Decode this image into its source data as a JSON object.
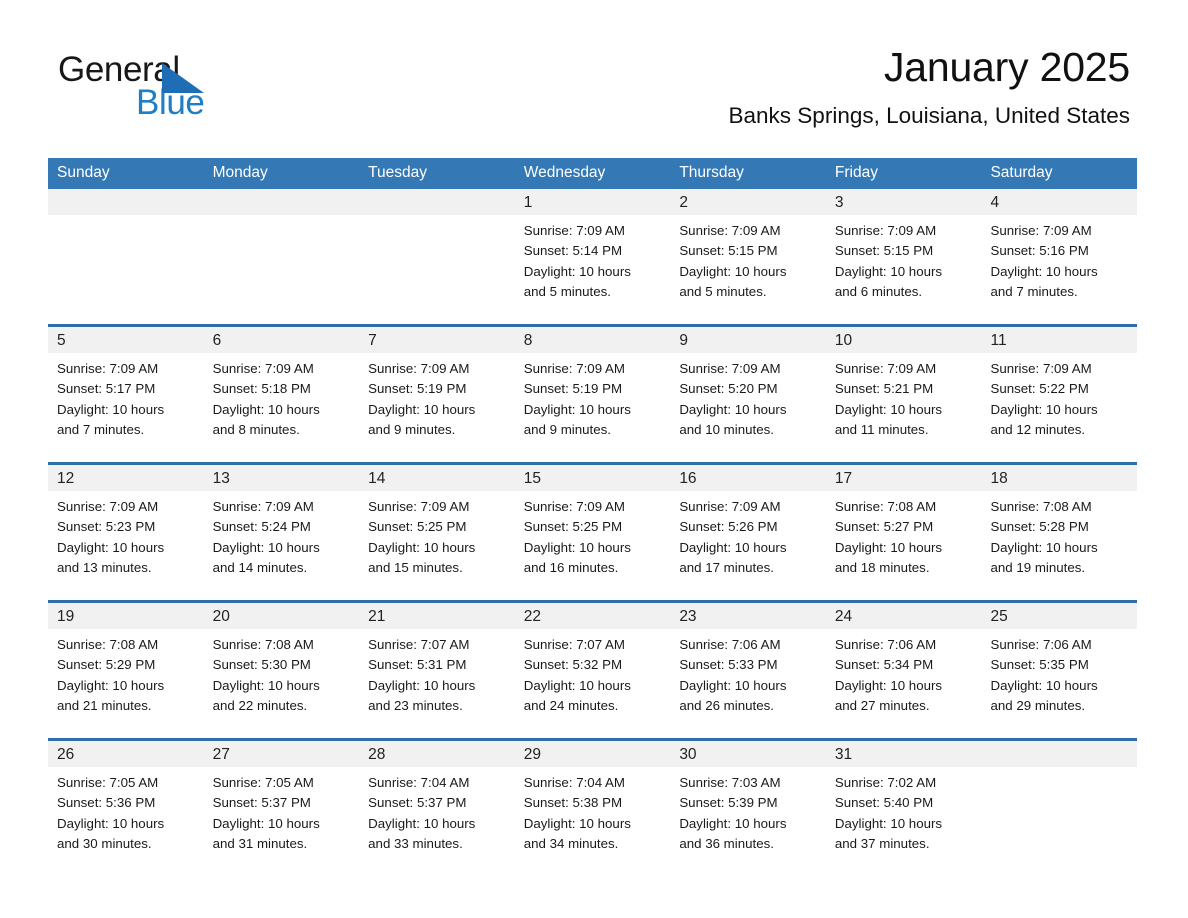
{
  "brand": {
    "name_part1": "General",
    "name_part2": "Blue",
    "flag_icon": "blue-triangle-flag-icon",
    "blue": "#1f7ec4"
  },
  "header": {
    "month_title": "January 2025",
    "location": "Banks Springs, Louisiana, United States"
  },
  "calendar": {
    "header_bg": "#3479b5",
    "row_border": "#2f6ea8",
    "day_band_bg": "#f1f1f1",
    "weekdays": [
      "Sunday",
      "Monday",
      "Tuesday",
      "Wednesday",
      "Thursday",
      "Friday",
      "Saturday"
    ],
    "weeks": [
      [
        {
          "day": "",
          "sunrise": "",
          "sunset": "",
          "daylight1": "",
          "daylight2": ""
        },
        {
          "day": "",
          "sunrise": "",
          "sunset": "",
          "daylight1": "",
          "daylight2": ""
        },
        {
          "day": "",
          "sunrise": "",
          "sunset": "",
          "daylight1": "",
          "daylight2": ""
        },
        {
          "day": "1",
          "sunrise": "Sunrise: 7:09 AM",
          "sunset": "Sunset: 5:14 PM",
          "daylight1": "Daylight: 10 hours",
          "daylight2": "and 5 minutes."
        },
        {
          "day": "2",
          "sunrise": "Sunrise: 7:09 AM",
          "sunset": "Sunset: 5:15 PM",
          "daylight1": "Daylight: 10 hours",
          "daylight2": "and 5 minutes."
        },
        {
          "day": "3",
          "sunrise": "Sunrise: 7:09 AM",
          "sunset": "Sunset: 5:15 PM",
          "daylight1": "Daylight: 10 hours",
          "daylight2": "and 6 minutes."
        },
        {
          "day": "4",
          "sunrise": "Sunrise: 7:09 AM",
          "sunset": "Sunset: 5:16 PM",
          "daylight1": "Daylight: 10 hours",
          "daylight2": "and 7 minutes."
        }
      ],
      [
        {
          "day": "5",
          "sunrise": "Sunrise: 7:09 AM",
          "sunset": "Sunset: 5:17 PM",
          "daylight1": "Daylight: 10 hours",
          "daylight2": "and 7 minutes."
        },
        {
          "day": "6",
          "sunrise": "Sunrise: 7:09 AM",
          "sunset": "Sunset: 5:18 PM",
          "daylight1": "Daylight: 10 hours",
          "daylight2": "and 8 minutes."
        },
        {
          "day": "7",
          "sunrise": "Sunrise: 7:09 AM",
          "sunset": "Sunset: 5:19 PM",
          "daylight1": "Daylight: 10 hours",
          "daylight2": "and 9 minutes."
        },
        {
          "day": "8",
          "sunrise": "Sunrise: 7:09 AM",
          "sunset": "Sunset: 5:19 PM",
          "daylight1": "Daylight: 10 hours",
          "daylight2": "and 9 minutes."
        },
        {
          "day": "9",
          "sunrise": "Sunrise: 7:09 AM",
          "sunset": "Sunset: 5:20 PM",
          "daylight1": "Daylight: 10 hours",
          "daylight2": "and 10 minutes."
        },
        {
          "day": "10",
          "sunrise": "Sunrise: 7:09 AM",
          "sunset": "Sunset: 5:21 PM",
          "daylight1": "Daylight: 10 hours",
          "daylight2": "and 11 minutes."
        },
        {
          "day": "11",
          "sunrise": "Sunrise: 7:09 AM",
          "sunset": "Sunset: 5:22 PM",
          "daylight1": "Daylight: 10 hours",
          "daylight2": "and 12 minutes."
        }
      ],
      [
        {
          "day": "12",
          "sunrise": "Sunrise: 7:09 AM",
          "sunset": "Sunset: 5:23 PM",
          "daylight1": "Daylight: 10 hours",
          "daylight2": "and 13 minutes."
        },
        {
          "day": "13",
          "sunrise": "Sunrise: 7:09 AM",
          "sunset": "Sunset: 5:24 PM",
          "daylight1": "Daylight: 10 hours",
          "daylight2": "and 14 minutes."
        },
        {
          "day": "14",
          "sunrise": "Sunrise: 7:09 AM",
          "sunset": "Sunset: 5:25 PM",
          "daylight1": "Daylight: 10 hours",
          "daylight2": "and 15 minutes."
        },
        {
          "day": "15",
          "sunrise": "Sunrise: 7:09 AM",
          "sunset": "Sunset: 5:25 PM",
          "daylight1": "Daylight: 10 hours",
          "daylight2": "and 16 minutes."
        },
        {
          "day": "16",
          "sunrise": "Sunrise: 7:09 AM",
          "sunset": "Sunset: 5:26 PM",
          "daylight1": "Daylight: 10 hours",
          "daylight2": "and 17 minutes."
        },
        {
          "day": "17",
          "sunrise": "Sunrise: 7:08 AM",
          "sunset": "Sunset: 5:27 PM",
          "daylight1": "Daylight: 10 hours",
          "daylight2": "and 18 minutes."
        },
        {
          "day": "18",
          "sunrise": "Sunrise: 7:08 AM",
          "sunset": "Sunset: 5:28 PM",
          "daylight1": "Daylight: 10 hours",
          "daylight2": "and 19 minutes."
        }
      ],
      [
        {
          "day": "19",
          "sunrise": "Sunrise: 7:08 AM",
          "sunset": "Sunset: 5:29 PM",
          "daylight1": "Daylight: 10 hours",
          "daylight2": "and 21 minutes."
        },
        {
          "day": "20",
          "sunrise": "Sunrise: 7:08 AM",
          "sunset": "Sunset: 5:30 PM",
          "daylight1": "Daylight: 10 hours",
          "daylight2": "and 22 minutes."
        },
        {
          "day": "21",
          "sunrise": "Sunrise: 7:07 AM",
          "sunset": "Sunset: 5:31 PM",
          "daylight1": "Daylight: 10 hours",
          "daylight2": "and 23 minutes."
        },
        {
          "day": "22",
          "sunrise": "Sunrise: 7:07 AM",
          "sunset": "Sunset: 5:32 PM",
          "daylight1": "Daylight: 10 hours",
          "daylight2": "and 24 minutes."
        },
        {
          "day": "23",
          "sunrise": "Sunrise: 7:06 AM",
          "sunset": "Sunset: 5:33 PM",
          "daylight1": "Daylight: 10 hours",
          "daylight2": "and 26 minutes."
        },
        {
          "day": "24",
          "sunrise": "Sunrise: 7:06 AM",
          "sunset": "Sunset: 5:34 PM",
          "daylight1": "Daylight: 10 hours",
          "daylight2": "and 27 minutes."
        },
        {
          "day": "25",
          "sunrise": "Sunrise: 7:06 AM",
          "sunset": "Sunset: 5:35 PM",
          "daylight1": "Daylight: 10 hours",
          "daylight2": "and 29 minutes."
        }
      ],
      [
        {
          "day": "26",
          "sunrise": "Sunrise: 7:05 AM",
          "sunset": "Sunset: 5:36 PM",
          "daylight1": "Daylight: 10 hours",
          "daylight2": "and 30 minutes."
        },
        {
          "day": "27",
          "sunrise": "Sunrise: 7:05 AM",
          "sunset": "Sunset: 5:37 PM",
          "daylight1": "Daylight: 10 hours",
          "daylight2": "and 31 minutes."
        },
        {
          "day": "28",
          "sunrise": "Sunrise: 7:04 AM",
          "sunset": "Sunset: 5:37 PM",
          "daylight1": "Daylight: 10 hours",
          "daylight2": "and 33 minutes."
        },
        {
          "day": "29",
          "sunrise": "Sunrise: 7:04 AM",
          "sunset": "Sunset: 5:38 PM",
          "daylight1": "Daylight: 10 hours",
          "daylight2": "and 34 minutes."
        },
        {
          "day": "30",
          "sunrise": "Sunrise: 7:03 AM",
          "sunset": "Sunset: 5:39 PM",
          "daylight1": "Daylight: 10 hours",
          "daylight2": "and 36 minutes."
        },
        {
          "day": "31",
          "sunrise": "Sunrise: 7:02 AM",
          "sunset": "Sunset: 5:40 PM",
          "daylight1": "Daylight: 10 hours",
          "daylight2": "and 37 minutes."
        },
        {
          "day": "",
          "sunrise": "",
          "sunset": "",
          "daylight1": "",
          "daylight2": ""
        }
      ]
    ]
  }
}
